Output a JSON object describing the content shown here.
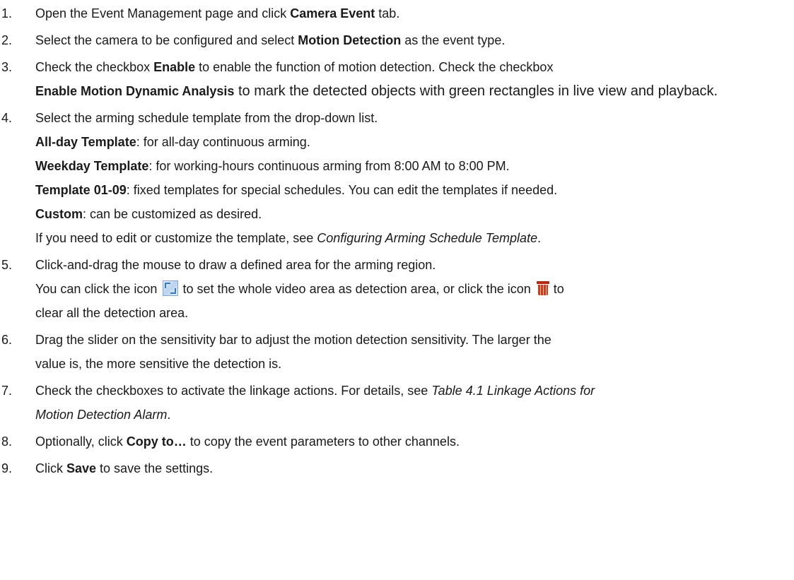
{
  "steps": [
    {
      "n": "1.",
      "a": "Open the Event Management page and click ",
      "b": "Camera Event",
      "c": " tab."
    },
    {
      "n": "2.",
      "a": "Select the camera to be configured and select ",
      "b": "Motion Detection",
      "c": " as the event type."
    },
    {
      "n": "3.",
      "a": "Check the checkbox ",
      "b": "Enable",
      "c": " to enable the function of motion detection. Check the checkbox",
      "b2": "Enable Motion Dynamic Analysis",
      "d": " to mark the detected objects with green rectangles in live view and playback."
    },
    {
      "n": "4.",
      "a": "Select the arming schedule template from the drop-down list.",
      "items": [
        {
          "b": "All-day Template",
          "t": ": for all-day continuous arming."
        },
        {
          "b": "Weekday Template",
          "t": ": for working-hours continuous arming from 8:00 AM to 8:00 PM."
        },
        {
          "b": "Template 01-09",
          "t": ": fixed templates for special schedules. You can edit the templates if needed."
        },
        {
          "b": "Custom",
          "t": ": can be customized as desired."
        }
      ],
      "note_a": "If you need to edit or customize the template, see ",
      "note_i": "Configuring Arming Schedule Template",
      "note_b": "."
    },
    {
      "n": "5.",
      "a": "Click-and-drag the mouse to draw a defined area for the arming region.",
      "l2a": "You can click the icon",
      "l2b": "to set the whole video area as detection area, or click the icon",
      "l2c": "to",
      "l3": "clear all the detection area.",
      "icon1": "full-screen-area-icon",
      "icon2": "trash-icon"
    },
    {
      "n": "6.",
      "a": "Drag the slider on the sensitivity bar to adjust the motion detection sensitivity. The larger the",
      "l2": "value is, the more sensitive the detection is."
    },
    {
      "n": "7.",
      "a": "Check the checkboxes to activate the linkage actions. For details, see ",
      "i": "Table 4.1 Linkage Actions for",
      "i2": "Motion Detection Alarm",
      "c": "."
    },
    {
      "n": "8.",
      "a": "Optionally, click ",
      "b": "Copy to…",
      "c": " to copy the event parameters to other channels."
    },
    {
      "n": "9.",
      "a": "Click ",
      "b": "Save",
      "c": " to save the settings."
    }
  ]
}
